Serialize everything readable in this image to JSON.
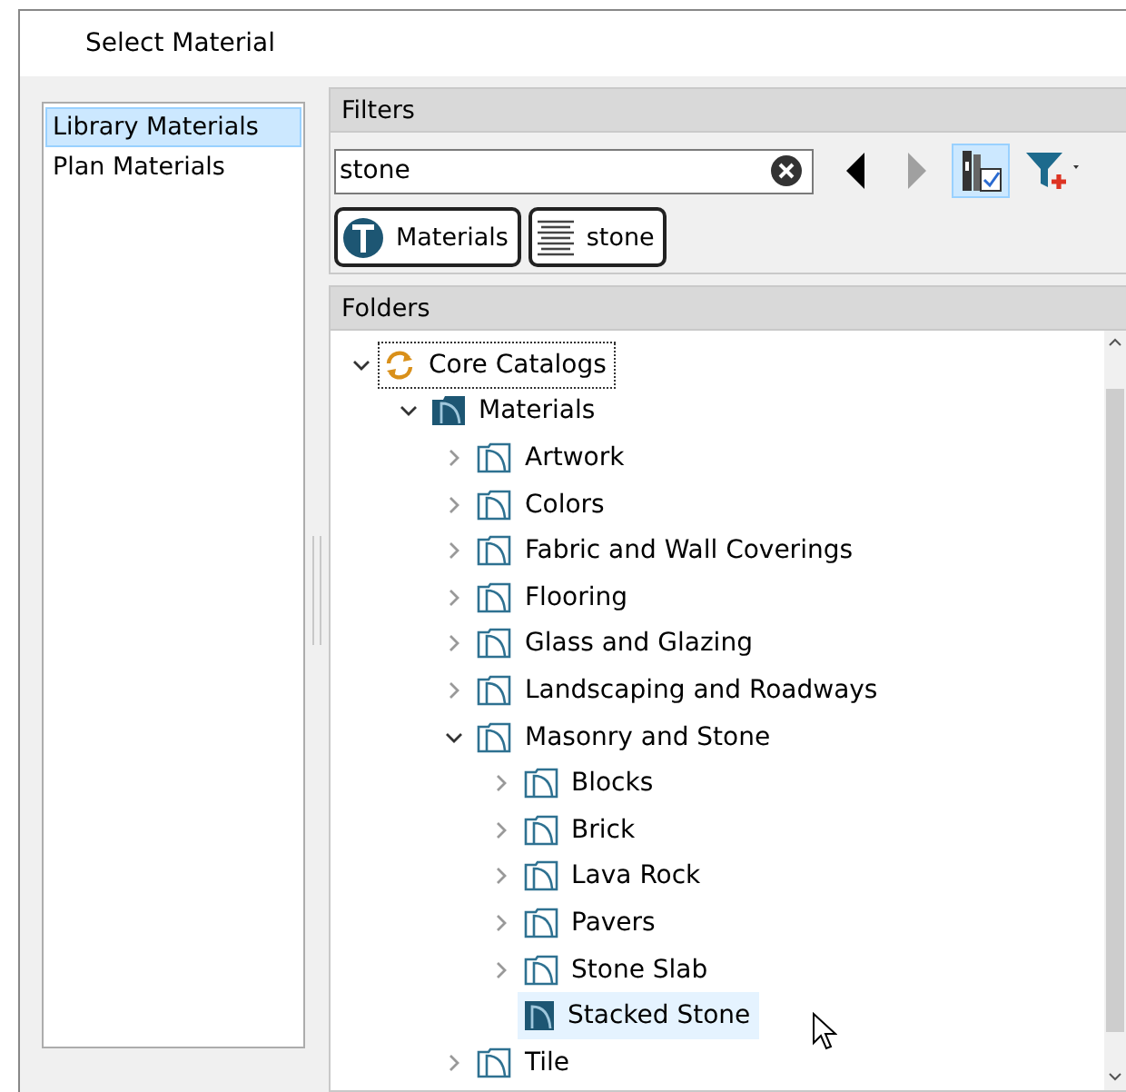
{
  "window": {
    "title": "Select Material"
  },
  "sources": [
    {
      "label": "Library Materials",
      "selected": true
    },
    {
      "label": "Plan Materials",
      "selected": false
    }
  ],
  "filters": {
    "heading": "Filters",
    "search": {
      "value": "stone"
    },
    "toolbar": [
      {
        "kind": "back",
        "disabled": false,
        "pressed": false
      },
      {
        "kind": "forward",
        "disabled": true,
        "pressed": false
      },
      {
        "kind": "toggle-view",
        "disabled": false,
        "pressed": true
      },
      {
        "kind": "add-filter",
        "disabled": false,
        "pressed": false
      }
    ],
    "chips": [
      {
        "kind": "type",
        "label": "Materials"
      },
      {
        "kind": "text",
        "label": "stone"
      }
    ]
  },
  "folders": {
    "heading": "Folders",
    "tree": [
      {
        "kind": "catalog",
        "label": "Core Catalogs",
        "expanded": true,
        "selected": false,
        "children": [
          {
            "kind": "library",
            "label": "Materials",
            "expanded": true,
            "selected": false,
            "children": [
              {
                "kind": "folder",
                "label": "Artwork",
                "expanded": false,
                "selected": false
              },
              {
                "kind": "folder",
                "label": "Colors",
                "expanded": false,
                "selected": false
              },
              {
                "kind": "folder",
                "label": "Fabric and Wall Coverings",
                "expanded": false,
                "selected": false
              },
              {
                "kind": "folder",
                "label": "Flooring",
                "expanded": false,
                "selected": false
              },
              {
                "kind": "folder",
                "label": "Glass and Glazing",
                "expanded": false,
                "selected": false
              },
              {
                "kind": "folder",
                "label": "Landscaping and Roadways",
                "expanded": false,
                "selected": false
              },
              {
                "kind": "folder",
                "label": "Masonry and Stone",
                "expanded": true,
                "selected": false,
                "children": [
                  {
                    "kind": "folder",
                    "label": "Blocks",
                    "expanded": false,
                    "selected": false
                  },
                  {
                    "kind": "folder",
                    "label": "Brick",
                    "expanded": false,
                    "selected": false
                  },
                  {
                    "kind": "folder",
                    "label": "Lava Rock",
                    "expanded": false,
                    "selected": false
                  },
                  {
                    "kind": "folder",
                    "label": "Pavers",
                    "expanded": false,
                    "selected": false
                  },
                  {
                    "kind": "folder",
                    "label": "Stone Slab",
                    "expanded": false,
                    "selected": false
                  },
                  {
                    "kind": "item",
                    "label": "Stacked Stone",
                    "selected": true
                  }
                ]
              },
              {
                "kind": "folder",
                "label": "Tile",
                "expanded": false,
                "selected": false
              }
            ]
          }
        ]
      }
    ]
  }
}
